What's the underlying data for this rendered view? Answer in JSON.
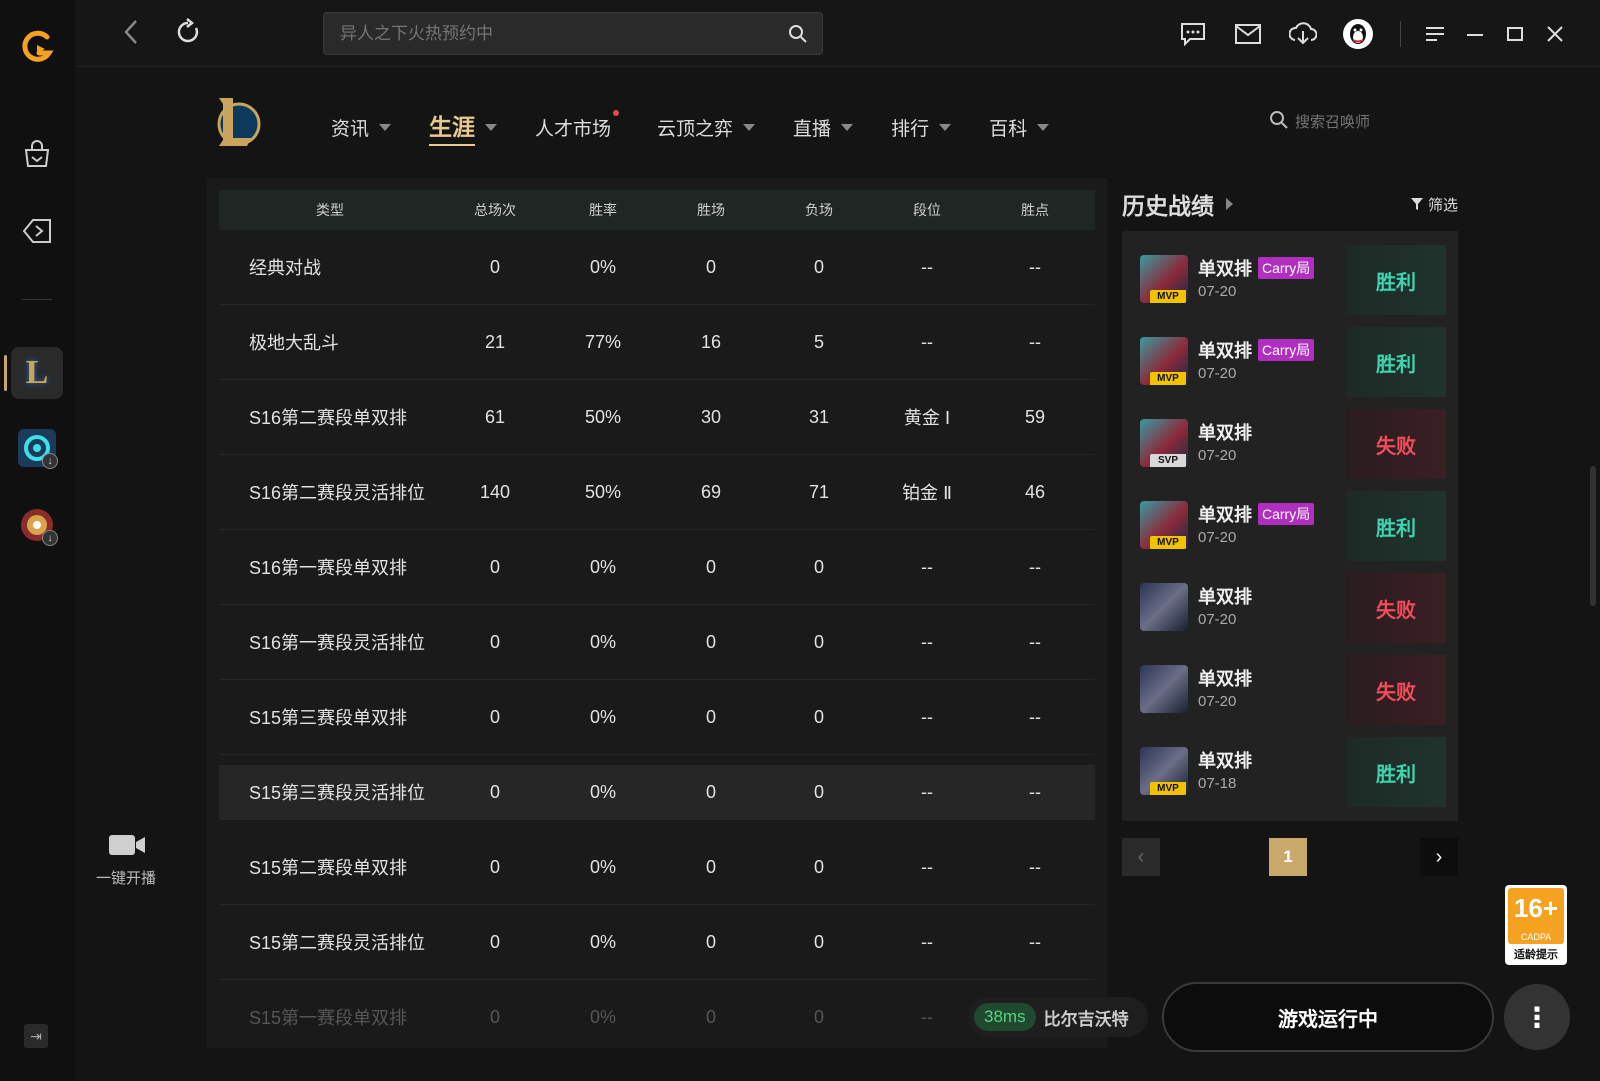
{
  "topbar": {
    "search_placeholder": "异人之下火热预约中"
  },
  "nav": {
    "tabs": [
      {
        "label": "资讯",
        "caret": true,
        "active": false,
        "dot": false
      },
      {
        "label": "生涯",
        "caret": true,
        "active": true,
        "dot": false
      },
      {
        "label": "人才市场",
        "caret": false,
        "active": false,
        "dot": true
      },
      {
        "label": "云顶之弈",
        "caret": true,
        "active": false,
        "dot": false
      },
      {
        "label": "直播",
        "caret": true,
        "active": false,
        "dot": false
      },
      {
        "label": "排行",
        "caret": true,
        "active": false,
        "dot": false
      },
      {
        "label": "百科",
        "caret": true,
        "active": false,
        "dot": false
      }
    ],
    "summoner_search_placeholder": "搜索召唤师"
  },
  "stats": {
    "headers": [
      "类型",
      "总场次",
      "胜率",
      "胜场",
      "负场",
      "段位",
      "胜点"
    ],
    "rows": [
      [
        "经典对战",
        "0",
        "0%",
        "0",
        "0",
        "--",
        "--"
      ],
      [
        "极地大乱斗",
        "21",
        "77%",
        "16",
        "5",
        "--",
        "--"
      ],
      [
        "S16第二赛段单双排",
        "61",
        "50%",
        "30",
        "31",
        "黄金 Ⅰ",
        "59"
      ],
      [
        "S16第二赛段灵活排位",
        "140",
        "50%",
        "69",
        "71",
        "铂金 Ⅱ",
        "46"
      ],
      [
        "S16第一赛段单双排",
        "0",
        "0%",
        "0",
        "0",
        "--",
        "--"
      ],
      [
        "S16第一赛段灵活排位",
        "0",
        "0%",
        "0",
        "0",
        "--",
        "--"
      ],
      [
        "S15第三赛段单双排",
        "0",
        "0%",
        "0",
        "0",
        "--",
        "--"
      ],
      [
        "S15第三赛段灵活排位",
        "0",
        "0%",
        "0",
        "0",
        "--",
        "--"
      ],
      [
        "S15第二赛段单双排",
        "0",
        "0%",
        "0",
        "0",
        "--",
        "--"
      ],
      [
        "S15第二赛段灵活排位",
        "0",
        "0%",
        "0",
        "0",
        "--",
        "--"
      ],
      [
        "S15第一赛段单双排",
        "0",
        "0%",
        "0",
        "0",
        "--",
        "--"
      ]
    ]
  },
  "history": {
    "title": "历史战绩",
    "filter_label": "筛选",
    "matches": [
      {
        "queue": "单双排",
        "tag": "Carry局",
        "date": "07-20",
        "badge": "MVP",
        "result": "胜利",
        "win": true
      },
      {
        "queue": "单双排",
        "tag": "Carry局",
        "date": "07-20",
        "badge": "MVP",
        "result": "胜利",
        "win": true
      },
      {
        "queue": "单双排",
        "tag": "",
        "date": "07-20",
        "badge": "SVP",
        "result": "失败",
        "win": false
      },
      {
        "queue": "单双排",
        "tag": "Carry局",
        "date": "07-20",
        "badge": "MVP",
        "result": "胜利",
        "win": true
      },
      {
        "queue": "单双排",
        "tag": "",
        "date": "07-20",
        "badge": "",
        "result": "失败",
        "win": false
      },
      {
        "queue": "单双排",
        "tag": "",
        "date": "07-20",
        "badge": "",
        "result": "失败",
        "win": false
      },
      {
        "queue": "单双排",
        "tag": "",
        "date": "07-18",
        "badge": "MVP",
        "result": "胜利",
        "win": true
      }
    ],
    "page": "1"
  },
  "live": {
    "stream_label": "一键开播"
  },
  "age_rating": {
    "value": "16+",
    "org": "CADPA",
    "caption": "适龄提示"
  },
  "footer": {
    "ping": "38ms",
    "server": "比尔吉沃特",
    "run_label": "游戏运行中"
  },
  "colors": {
    "accent_gold": "#c8a86b",
    "win": "#3fd4b0",
    "lose": "#f04d5b",
    "carry_tag": "#b02fc0"
  }
}
